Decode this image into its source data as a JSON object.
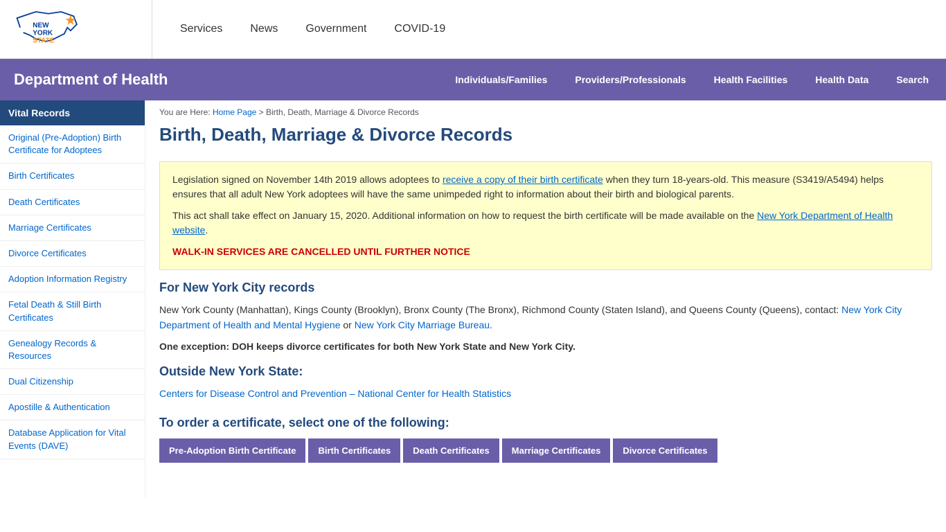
{
  "topNav": {
    "links": [
      {
        "label": "Services",
        "id": "services"
      },
      {
        "label": "News",
        "id": "news"
      },
      {
        "label": "Government",
        "id": "government"
      },
      {
        "label": "COVID-19",
        "id": "covid19"
      }
    ]
  },
  "deptHeader": {
    "title": "Department of Health",
    "navLinks": [
      {
        "label": "Individuals/Families",
        "id": "individuals"
      },
      {
        "label": "Providers/Professionals",
        "id": "providers"
      },
      {
        "label": "Health Facilities",
        "id": "healthfacilities"
      },
      {
        "label": "Health Data",
        "id": "healthdata"
      },
      {
        "label": "Search",
        "id": "search"
      }
    ]
  },
  "sidebar": {
    "heading": "Vital Records",
    "items": [
      {
        "label": "Original (Pre-Adoption) Birth Certificate for Adoptees",
        "id": "pre-adoption"
      },
      {
        "label": "Birth Certificates",
        "id": "birth-cert"
      },
      {
        "label": "Death Certificates",
        "id": "death-cert"
      },
      {
        "label": "Marriage Certificates",
        "id": "marriage-cert"
      },
      {
        "label": "Divorce Certificates",
        "id": "divorce-cert"
      },
      {
        "label": "Adoption Information Registry",
        "id": "adoption-registry"
      },
      {
        "label": "Fetal Death & Still Birth Certificates",
        "id": "fetal-death"
      },
      {
        "label": "Genealogy Records & Resources",
        "id": "genealogy"
      },
      {
        "label": "Dual Citizenship",
        "id": "dual-citizenship"
      },
      {
        "label": "Apostille & Authentication",
        "id": "apostille"
      },
      {
        "label": "Database Application for Vital Events (DAVE)",
        "id": "dave"
      }
    ]
  },
  "breadcrumb": {
    "homeLabel": "Home Page",
    "currentLabel": "Birth, Death, Marriage & Divorce Records"
  },
  "main": {
    "pageTitle": "Birth, Death, Marriage & Divorce Records",
    "infoBox": {
      "para1Start": "Legislation signed on November 14th 2019 allows adoptees to ",
      "para1LinkText": "receive a copy of their birth certificate",
      "para1End": " when they turn 18-years-old. This measure (S3419/A5494) helps ensures that all adult New York adoptees will have the same unimpeded right to information about their birth and biological parents.",
      "para2Start": "This act shall take effect on January 15, 2020. Additional information on how to request the birth certificate will be made available on the ",
      "para2LinkText": "New York Department of Health website",
      "para2End": ".",
      "walkInNotice": "WALK-IN SERVICES ARE CANCELLED UNTIL FURTHER NOTICE"
    },
    "nycSection": {
      "heading": "For New York City records",
      "text1Start": "New York County (Manhattan), Kings County (Brooklyn), Bronx County (The Bronx), Richmond County (Staten Island), and Queens County (Queens), contact: ",
      "link1Text": "New York City Department of Health and Mental Hygiene",
      "text1Mid": " or ",
      "link2Text": "New York City Marriage Bureau",
      "text1End": ".",
      "boldText": "One exception: DOH keeps divorce certificates for both New York State and New York City."
    },
    "outsideNYSection": {
      "heading": "Outside New York State:",
      "linkText": "Centers for Disease Control and Prevention – National Center for Health Statistics"
    },
    "orderSection": {
      "heading": "To order a certificate, select one of the following:",
      "buttons": [
        {
          "label": "Pre-Adoption Birth Certificate",
          "id": "btn-pre-adoption"
        },
        {
          "label": "Birth Certificates",
          "id": "btn-birth"
        },
        {
          "label": "Death Certificates",
          "id": "btn-death"
        },
        {
          "label": "Marriage Certificates",
          "id": "btn-marriage"
        },
        {
          "label": "Divorce Certificates",
          "id": "btn-divorce"
        }
      ]
    }
  }
}
